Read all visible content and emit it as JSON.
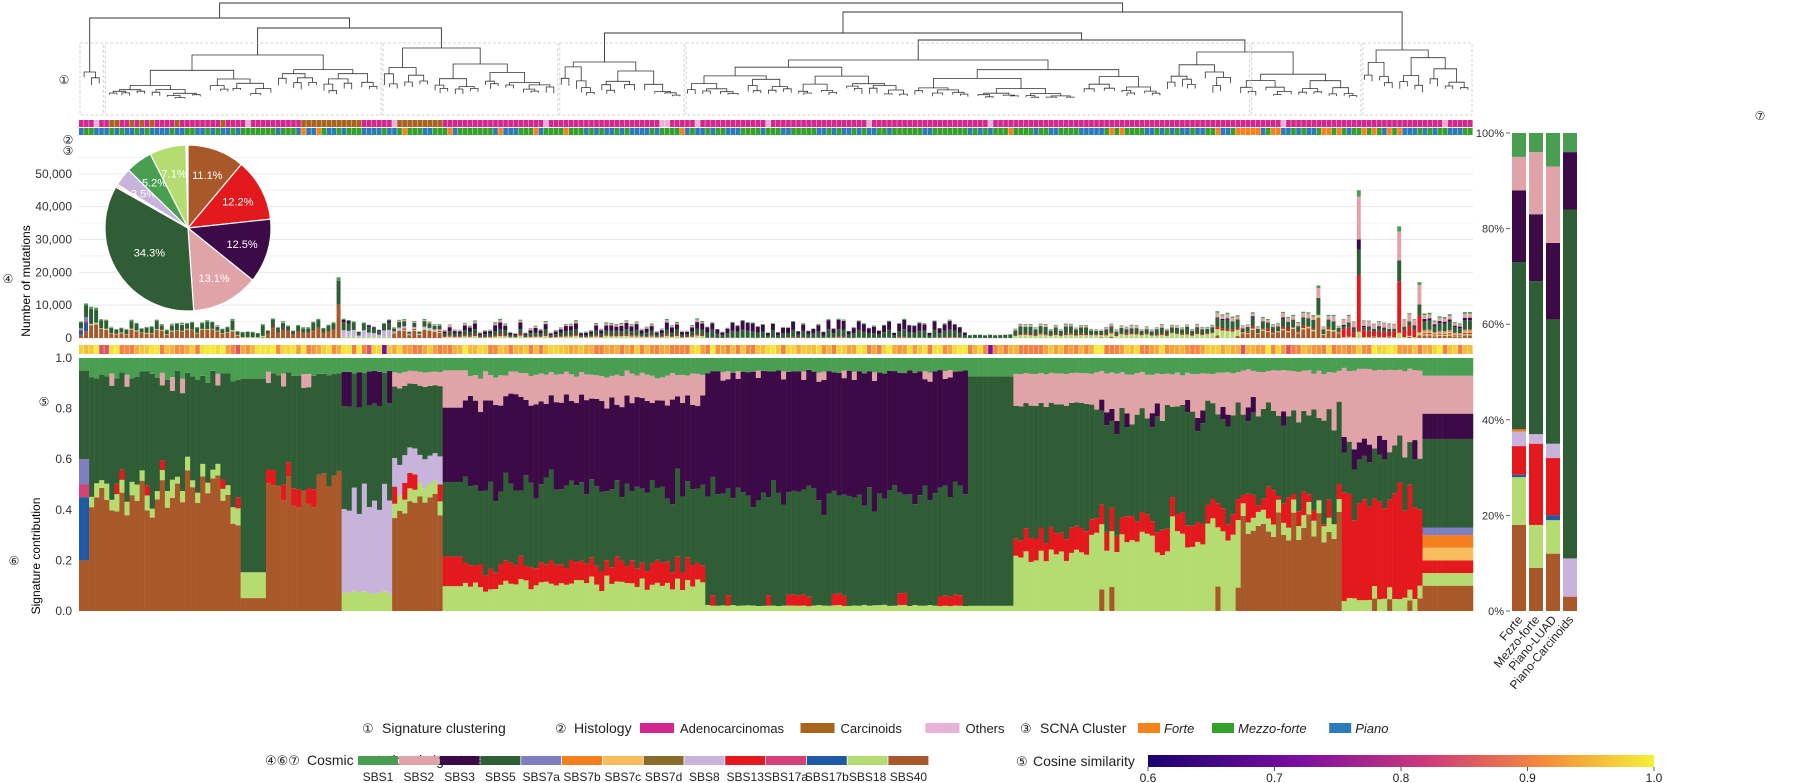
{
  "chart_data": {
    "type": "bar",
    "markers": {
      "dendrogram": "①",
      "histology": "②",
      "scna": "③",
      "mutations": "④",
      "cosine": "⑤",
      "contribution": "⑥",
      "summary": "⑦"
    },
    "panel_dendrogram": {
      "marker": "①",
      "legend_title": "Signature clustering"
    },
    "panel_mutations": {
      "ylabel": "Number of mutations",
      "ylim": [
        0,
        60000
      ],
      "yticks": [
        "0",
        "10,000",
        "20,000",
        "30,000",
        "40,000",
        "50,000"
      ],
      "notable_totals": [
        {
          "sample_index": 51,
          "total": 18500
        },
        {
          "sample_index": 245,
          "total": 16000
        },
        {
          "sample_index": 253,
          "total": 45000
        },
        {
          "sample_index": 261,
          "total": 34000
        },
        {
          "sample_index": 265,
          "total": 17000
        }
      ]
    },
    "panel_contribution": {
      "ylabel": "Signature contribution",
      "ylim": [
        0,
        1
      ],
      "yticks": [
        "0.0",
        "0.2",
        "0.4",
        "0.6",
        "0.8",
        "1.0"
      ]
    },
    "pie": {
      "slices": [
        {
          "signature": "SBS40",
          "percent": 11.1,
          "label": "11.1%"
        },
        {
          "signature": "SBS13",
          "percent": 12.2,
          "label": "12.2%"
        },
        {
          "signature": "SBS3",
          "percent": 12.5,
          "label": "12.5%"
        },
        {
          "signature": "SBS2",
          "percent": 13.1,
          "label": "13.1%"
        },
        {
          "signature": "SBS5",
          "percent": 34.3,
          "label": "34.3%"
        },
        {
          "signature": "SBS7b",
          "percent": 0.3,
          "label": ""
        },
        {
          "signature": "SBS7c",
          "percent": 0.3,
          "label": ""
        },
        {
          "signature": "SBS8",
          "percent": 3.5,
          "label": "3.5%"
        },
        {
          "signature": "SBS1",
          "percent": 5.2,
          "label": "5.2%"
        },
        {
          "signature": "SBS18",
          "percent": 7.1,
          "label": "7.1%"
        }
      ]
    },
    "panel_summary": {
      "yticks": [
        "0%",
        "20%",
        "40%",
        "60%",
        "80%",
        "100%"
      ],
      "categories": [
        "Forte",
        "Mezzo-forte",
        "Piano-LUAD",
        "Piano-Carcinoids"
      ],
      "series": [
        {
          "signature": "SBS40",
          "values": [
            18,
            9,
            12,
            3
          ]
        },
        {
          "signature": "SBS18",
          "values": [
            10,
            9,
            7,
            0
          ]
        },
        {
          "signature": "SBS17b",
          "values": [
            0.5,
            0,
            1,
            0
          ]
        },
        {
          "signature": "SBS17a",
          "values": [
            0,
            0,
            0,
            0
          ]
        },
        {
          "signature": "SBS13",
          "values": [
            6,
            17,
            12,
            0
          ]
        },
        {
          "signature": "SBS8",
          "values": [
            3,
            2,
            3,
            8
          ]
        },
        {
          "signature": "SBS7d",
          "values": [
            0,
            0,
            0,
            0
          ]
        },
        {
          "signature": "SBS7c",
          "values": [
            0,
            0,
            0,
            0
          ]
        },
        {
          "signature": "SBS7b",
          "values": [
            0.5,
            0,
            0,
            0
          ]
        },
        {
          "signature": "SBS7a",
          "values": [
            0,
            0,
            0,
            0
          ]
        },
        {
          "signature": "SBS5",
          "values": [
            35,
            32,
            26,
            73
          ]
        },
        {
          "signature": "SBS3",
          "values": [
            15,
            14,
            16,
            12
          ]
        },
        {
          "signature": "SBS2",
          "values": [
            7,
            13,
            16,
            0
          ]
        },
        {
          "signature": "SBS1",
          "values": [
            5,
            4,
            7,
            4
          ]
        }
      ]
    },
    "signatures": [
      {
        "name": "SBS1",
        "color": "#4a9e52"
      },
      {
        "name": "SBS2",
        "color": "#e0a4a8"
      },
      {
        "name": "SBS3",
        "color": "#3c0a46"
      },
      {
        "name": "SBS5",
        "color": "#2f5d35"
      },
      {
        "name": "SBS7a",
        "color": "#7e7ec0"
      },
      {
        "name": "SBS7b",
        "color": "#f47f1e"
      },
      {
        "name": "SBS7c",
        "color": "#f9bd5e"
      },
      {
        "name": "SBS7d",
        "color": "#8a6c2a"
      },
      {
        "name": "SBS8",
        "color": "#c8b3dc"
      },
      {
        "name": "SBS13",
        "color": "#e3191e"
      },
      {
        "name": "SBS17a",
        "color": "#d6417a"
      },
      {
        "name": "SBS17b",
        "color": "#1f5aa6"
      },
      {
        "name": "SBS18",
        "color": "#b5dc70"
      },
      {
        "name": "SBS40",
        "color": "#a9582a"
      }
    ],
    "legends": {
      "clustering": {
        "marker": "①",
        "title": "Signature clustering"
      },
      "histology": {
        "marker": "②",
        "title": "Histology",
        "items": [
          {
            "label": "Adenocarcinomas",
            "color": "#d4268f"
          },
          {
            "label": "Carcinoids",
            "color": "#a8631c"
          },
          {
            "label": "Others",
            "color": "#eab2d8"
          }
        ]
      },
      "scna": {
        "marker": "③",
        "title": "SCNA Cluster",
        "items": [
          {
            "label": "Forte",
            "color": "#f7821c"
          },
          {
            "label": "Mezzo-forte",
            "color": "#33a02c"
          },
          {
            "label": "Piano",
            "color": "#2b7bb9"
          }
        ]
      },
      "cosmic": {
        "markers": "④⑥⑦",
        "title": "Cosmic mutational signatures"
      },
      "cosine": {
        "marker": "⑤",
        "title": "Cosine similarity",
        "ticks": [
          "0.6",
          "0.7",
          "0.8",
          "0.9",
          "1.0"
        ]
      }
    }
  }
}
